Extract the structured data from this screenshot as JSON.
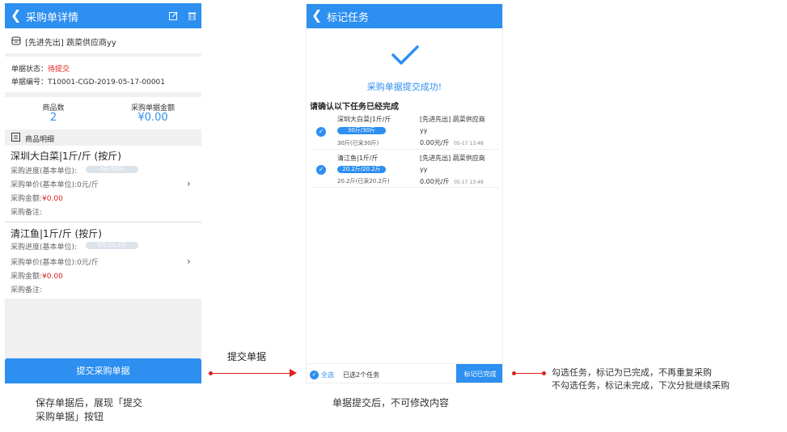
{
  "left_phone": {
    "title": "采购单详情",
    "supplier": "[先进先出] 蔬菜供应商yy",
    "status_label": "单据状态：",
    "status_value": "待提交",
    "number_label": "单据编号：",
    "number_value": "T10001-CGD-2019-05-17-00001",
    "count_label": "商品数",
    "count_value": "2",
    "amount_label": "采购单据金额",
    "amount_value": "¥0.00",
    "detail_header": "商品明细",
    "items": [
      {
        "name": "深圳大白菜|1斤/斤 (按斤)",
        "progress_label": "采购进度(基本单位):",
        "progress_text": "0斤/30斤",
        "progress_fraction": 0,
        "price_label": "采购单价(基本单位):",
        "price_value": "0元/斤",
        "amount_label": "采购金额:",
        "amount_value": "¥0.00",
        "note_label": "采购备注:"
      },
      {
        "name": "清江鱼|1斤/斤 (按斤)",
        "progress_label": "采购进度(基本单位):",
        "progress_text": "0斤/20.2斤",
        "progress_fraction": 0,
        "price_label": "采购单价(基本单位):",
        "price_value": "0元/斤",
        "amount_label": "采购金额:",
        "amount_value": "¥0.00",
        "note_label": "采购备注:"
      }
    ],
    "submit_button": "提交采购单据"
  },
  "right_phone": {
    "title": "标记任务",
    "success_text": "采购单据提交成功!",
    "confirm_title": "请确认以下任务已经完成",
    "tasks": [
      {
        "name": "深圳大白菜|1斤/斤",
        "pill": "30斤/30斤",
        "progress_fraction": 1,
        "sub": "30斤(已采30斤)",
        "supplier_line1": "[先进先出] 蔬菜供应商",
        "supplier_line2": "yy",
        "price": "0.00元/斤",
        "time": "05-17 13:48"
      },
      {
        "name": "清江鱼|1斤/斤",
        "pill": "20.2斤/20.2斤",
        "progress_fraction": 1,
        "sub": "20.2斤(已采20.2斤)",
        "supplier_line1": "[先进先出] 蔬菜供应商",
        "supplier_line2": "yy",
        "price": "0.00元/斤",
        "time": "05-17 13:48"
      }
    ],
    "select_all": "全选",
    "selected_count": "已选2个任务",
    "mark_done_button": "标记已完成"
  },
  "annotations": {
    "submit_label": "提交单据",
    "left_caption_line1": "保存单据后，展现「提交",
    "left_caption_line2": "采购单据」按钮",
    "middle_caption": "单据提交后，不可修改内容",
    "right_note_line1": "勾选任务，标记为已完成，不再重复采购",
    "right_note_line2": "不勾选任务，标记未完成，下次分批继续采购"
  },
  "colors": {
    "accent": "#2d8ff0",
    "warning": "#e02020"
  },
  "icons": [
    "back-arrow-icon",
    "edit-icon",
    "delete-icon",
    "store-icon",
    "list-icon",
    "chevron-right-icon",
    "checkmark-icon",
    "check-circle-icon"
  ]
}
